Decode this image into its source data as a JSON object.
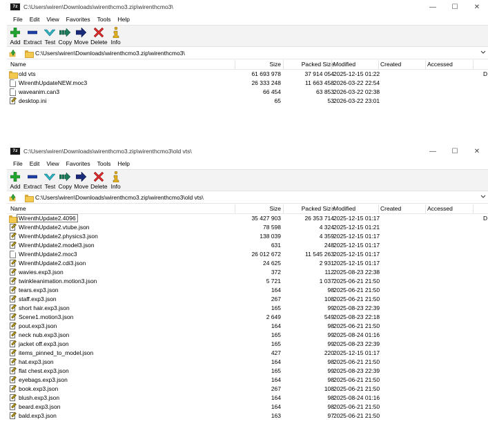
{
  "windows": [
    {
      "title": "C:\\Users\\wiren\\Downloads\\wirenthcmo3.zip\\wirenthcmo3\\",
      "app_icon_text": "7z",
      "menu": [
        "File",
        "Edit",
        "View",
        "Favorites",
        "Tools",
        "Help"
      ],
      "toolbar": [
        "Add",
        "Extract",
        "Test",
        "Copy",
        "Move",
        "Delete",
        "Info"
      ],
      "address": "C:\\Users\\wiren\\Downloads\\wirenthcmo3.zip\\wirenthcmo3\\",
      "columns": {
        "name": "Name",
        "size": "Size",
        "packed": "Packed Size",
        "modified": "Modified",
        "created": "Created",
        "accessed": "Accessed"
      },
      "extra_col_char": "D",
      "rows": [
        {
          "icon": "folder",
          "name": "old vts",
          "size": "61 693 978",
          "packed": "37 914 054",
          "modified": "2025-12-15 01:22",
          "extra": "D"
        },
        {
          "icon": "doc",
          "name": "WirenthUpdateNEW.moc3",
          "size": "26 333 248",
          "packed": "11 663 458",
          "modified": "2026-03-22 22:54",
          "extra": ""
        },
        {
          "icon": "doc",
          "name": "waveanim.can3",
          "size": "66 454",
          "packed": "63 853",
          "modified": "2026-03-22 02:38",
          "extra": ""
        },
        {
          "icon": "json",
          "name": "desktop.ini",
          "size": "65",
          "packed": "53",
          "modified": "2026-03-22 23:01",
          "extra": ""
        }
      ]
    },
    {
      "title": "C:\\Users\\wiren\\Downloads\\wirenthcmo3.zip\\wirenthcmo3\\old vts\\",
      "app_icon_text": "7z",
      "menu": [
        "File",
        "Edit",
        "View",
        "Favorites",
        "Tools",
        "Help"
      ],
      "toolbar": [
        "Add",
        "Extract",
        "Test",
        "Copy",
        "Move",
        "Delete",
        "Info"
      ],
      "address": "C:\\Users\\wiren\\Downloads\\wirenthcmo3.zip\\wirenthcmo3\\old vts\\",
      "columns": {
        "name": "Name",
        "size": "Size",
        "packed": "Packed Size",
        "modified": "Modified",
        "created": "Created",
        "accessed": "Accessed"
      },
      "extra_col_char": "D",
      "rows": [
        {
          "icon": "folder",
          "name": "WirenthUpdate2.4096",
          "size": "35 427 903",
          "packed": "26 353 714",
          "modified": "2025-12-15 01:17",
          "extra": "D",
          "focused": true
        },
        {
          "icon": "json",
          "name": "WirenthUpdate2.vtube.json",
          "size": "78 598",
          "packed": "4 324",
          "modified": "2025-12-15 01:21",
          "extra": ""
        },
        {
          "icon": "json",
          "name": "WirenthUpdate2.physics3.json",
          "size": "138 039",
          "packed": "4 359",
          "modified": "2025-12-15 01:17",
          "extra": ""
        },
        {
          "icon": "json",
          "name": "WirenthUpdate2.model3.json",
          "size": "631",
          "packed": "248",
          "modified": "2025-12-15 01:17",
          "extra": ""
        },
        {
          "icon": "doc",
          "name": "WirenthUpdate2.moc3",
          "size": "26 012 672",
          "packed": "11 545 263",
          "modified": "2025-12-15 01:17",
          "extra": ""
        },
        {
          "icon": "json",
          "name": "WirenthUpdate2.cdi3.json",
          "size": "24 625",
          "packed": "2 931",
          "modified": "2025-12-15 01:17",
          "extra": ""
        },
        {
          "icon": "json",
          "name": "wavies.exp3.json",
          "size": "372",
          "packed": "112",
          "modified": "2025-08-23 22:38",
          "extra": ""
        },
        {
          "icon": "json",
          "name": "twinkleanimation.motion3.json",
          "size": "5 721",
          "packed": "1 037",
          "modified": "2025-06-21 21:50",
          "extra": ""
        },
        {
          "icon": "json",
          "name": "tears.exp3.json",
          "size": "164",
          "packed": "98",
          "modified": "2025-06-21 21:50",
          "extra": ""
        },
        {
          "icon": "json",
          "name": "staff.exp3.json",
          "size": "267",
          "packed": "108",
          "modified": "2025-06-21 21:50",
          "extra": ""
        },
        {
          "icon": "json",
          "name": "short hair.exp3.json",
          "size": "165",
          "packed": "99",
          "modified": "2025-08-23 22:39",
          "extra": ""
        },
        {
          "icon": "json",
          "name": "Scene1.motion3.json",
          "size": "2 649",
          "packed": "549",
          "modified": "2025-08-23 22:18",
          "extra": ""
        },
        {
          "icon": "json",
          "name": "pout.exp3.json",
          "size": "164",
          "packed": "98",
          "modified": "2025-06-21 21:50",
          "extra": ""
        },
        {
          "icon": "json",
          "name": "neck nub.exp3.json",
          "size": "165",
          "packed": "99",
          "modified": "2025-08-24 01:16",
          "extra": ""
        },
        {
          "icon": "json",
          "name": "jacket off.exp3.json",
          "size": "165",
          "packed": "99",
          "modified": "2025-08-23 22:39",
          "extra": ""
        },
        {
          "icon": "json",
          "name": "items_pinned_to_model.json",
          "size": "427",
          "packed": "220",
          "modified": "2025-12-15 01:17",
          "extra": ""
        },
        {
          "icon": "json",
          "name": "hat.exp3.json",
          "size": "164",
          "packed": "98",
          "modified": "2025-06-21 21:50",
          "extra": ""
        },
        {
          "icon": "json",
          "name": "flat chest.exp3.json",
          "size": "165",
          "packed": "99",
          "modified": "2025-08-23 22:39",
          "extra": ""
        },
        {
          "icon": "json",
          "name": "eyebags.exp3.json",
          "size": "164",
          "packed": "98",
          "modified": "2025-06-21 21:50",
          "extra": ""
        },
        {
          "icon": "json",
          "name": "book.exp3.json",
          "size": "267",
          "packed": "108",
          "modified": "2025-06-21 21:50",
          "extra": ""
        },
        {
          "icon": "json",
          "name": "blush.exp3.json",
          "size": "164",
          "packed": "98",
          "modified": "2025-08-24 01:16",
          "extra": ""
        },
        {
          "icon": "json",
          "name": "beard.exp3.json",
          "size": "164",
          "packed": "98",
          "modified": "2025-06-21 21:50",
          "extra": ""
        },
        {
          "icon": "json",
          "name": "bald.exp3.json",
          "size": "163",
          "packed": "97",
          "modified": "2025-06-21 21:50",
          "extra": ""
        }
      ]
    }
  ],
  "icons": {
    "toolbar": [
      "add-icon",
      "extract-icon",
      "test-icon",
      "copy-icon",
      "move-icon",
      "delete-icon",
      "info-icon"
    ],
    "up": "up-folder-icon",
    "colors": {
      "add": "#22a52f",
      "extract": "#1e3fa6",
      "test": "#2fb4c4",
      "copy": "#1d7a5a",
      "move": "#1b2b7a",
      "delete": "#d42a2a",
      "info": "#e0b020"
    }
  }
}
